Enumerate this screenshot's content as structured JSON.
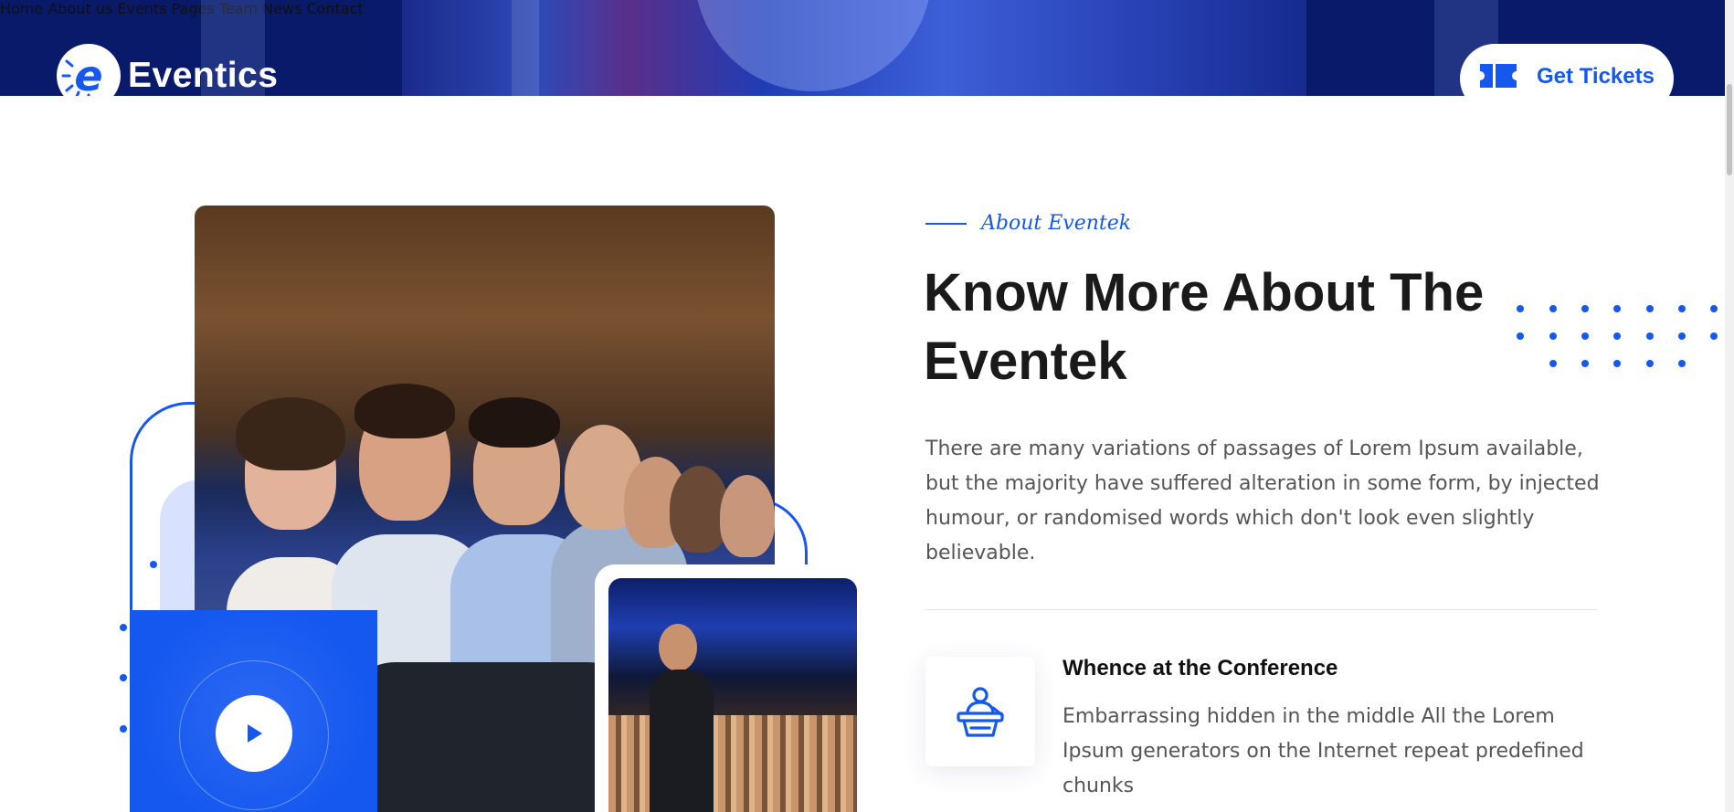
{
  "brand": {
    "logo_letter": "e",
    "name": "Eventics",
    "accent_color": "#1558f0",
    "header_color": "#0a1a6b"
  },
  "nav": {
    "items": [
      {
        "label": "Home"
      },
      {
        "label": "About us"
      },
      {
        "label": "Events"
      },
      {
        "label": "Pages"
      },
      {
        "label": "Team"
      },
      {
        "label": "News"
      },
      {
        "label": "Contact"
      }
    ],
    "cta": {
      "label": "Get Tickets",
      "icon": "ticket-icon"
    }
  },
  "about": {
    "kicker": "About Eventek",
    "title": "Know More About The Eventek",
    "description": "There are many variations of passages of Lorem Ipsum available, but the majority have suffered alteration in some form, by injected humour, or randomised words which don't look even slightly believable.",
    "feature": {
      "icon": "speaker-podium-icon",
      "title": "Whence at the Conference",
      "description": "Embarrassing hidden in the middle All the Lorem Ipsum generators on the Internet repeat predefined chunks"
    }
  },
  "media": {
    "main_image": "audience-seated-photo",
    "small_image": "speaker-on-stage-photo",
    "video_button_icon": "play-icon"
  }
}
